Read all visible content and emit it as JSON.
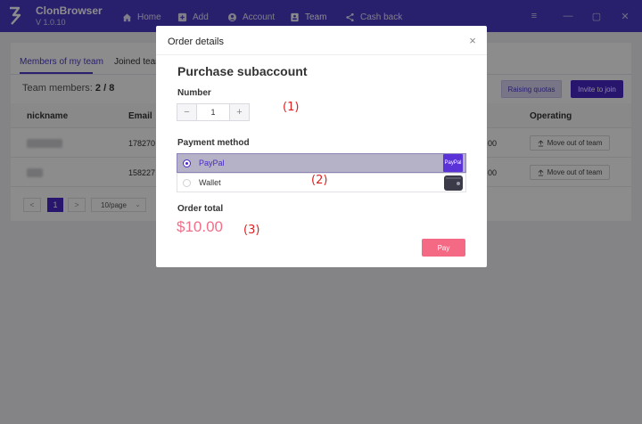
{
  "app": {
    "name": "ClonBrowser",
    "version": "V 1.0.10"
  },
  "nav": [
    {
      "label": "Home",
      "icon": "home-icon"
    },
    {
      "label": "Add",
      "icon": "plus-square-icon"
    },
    {
      "label": "Account",
      "icon": "user-icon"
    },
    {
      "label": "Team",
      "icon": "team-icon",
      "active": true
    },
    {
      "label": "Cash back",
      "icon": "share-icon"
    }
  ],
  "window_controls": {
    "menu": "≡",
    "minimize": "—",
    "maximize": "▢",
    "close": "✕"
  },
  "tabs": [
    {
      "label": "Members of my team",
      "active": true
    },
    {
      "label": "Joined team"
    }
  ],
  "members": {
    "label": "Team members:",
    "count": "2 / 8"
  },
  "buttons": {
    "raising_quotas": "Raising quotas",
    "invite": "Invite to join"
  },
  "table": {
    "columns": [
      "nickname",
      "Email",
      "Operating"
    ],
    "rows": [
      {
        "email": "178270",
        "time": "00",
        "action": "Move out of team"
      },
      {
        "email": "158227",
        "time": "00",
        "action": "Move out of team"
      }
    ]
  },
  "pager": {
    "prev": "<",
    "page": "1",
    "next": ">",
    "page_size": "10/page"
  },
  "modal": {
    "header": "Order details",
    "close": "×",
    "title": "Purchase subaccount",
    "number_label": "Number",
    "stepper": {
      "minus": "−",
      "value": "1",
      "plus": "+"
    },
    "payment_label": "Payment method",
    "options": [
      {
        "label": "PayPal",
        "selected": true,
        "badge": "PayPal"
      },
      {
        "label": "Wallet",
        "selected": false
      }
    ],
    "total_label": "Order total",
    "total": "$10.00",
    "pay_button": "Pay"
  },
  "annotations": [
    "(1)",
    "(2)",
    "(3)"
  ],
  "colors": {
    "brand": "#4a3bc6",
    "accent": "#4a27c8",
    "pay": "#f46a85",
    "total": "#f0708a",
    "annotation": "#e02020"
  }
}
